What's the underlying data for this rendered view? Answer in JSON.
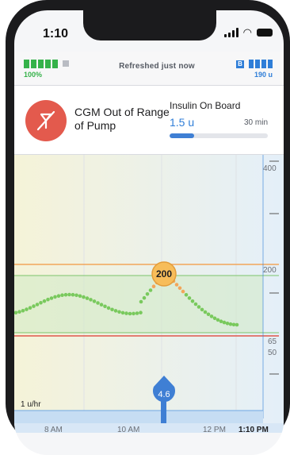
{
  "status": {
    "time": "1:10"
  },
  "header": {
    "pump_battery": "100%",
    "refresh": "Refreshed just now",
    "insulin_badge": "B",
    "insulin_remaining": "190 u"
  },
  "alert": {
    "title": "CGM Out of Range of Pump",
    "icon": "cgm-out-of-range-icon"
  },
  "iob": {
    "title": "Insulin On Board",
    "value": "1.5 u",
    "time": "30 min",
    "progress": 0.25
  },
  "chart_data": {
    "type": "line",
    "x_ticks": [
      "8 AM",
      "10 AM",
      "12 PM",
      "1:10 PM"
    ],
    "y_ticks": [
      "400",
      "200",
      "65",
      "50"
    ],
    "high_target": 200,
    "low_target": 65,
    "current_bg": "200",
    "bolus_value": "4.6",
    "basal_label": "1 u/hr",
    "colors": {
      "high": "#f2a65a",
      "low": "#e0574a",
      "range": "#7cc46b",
      "glucose": "#79c95d",
      "now": "#2f7ed8"
    }
  }
}
